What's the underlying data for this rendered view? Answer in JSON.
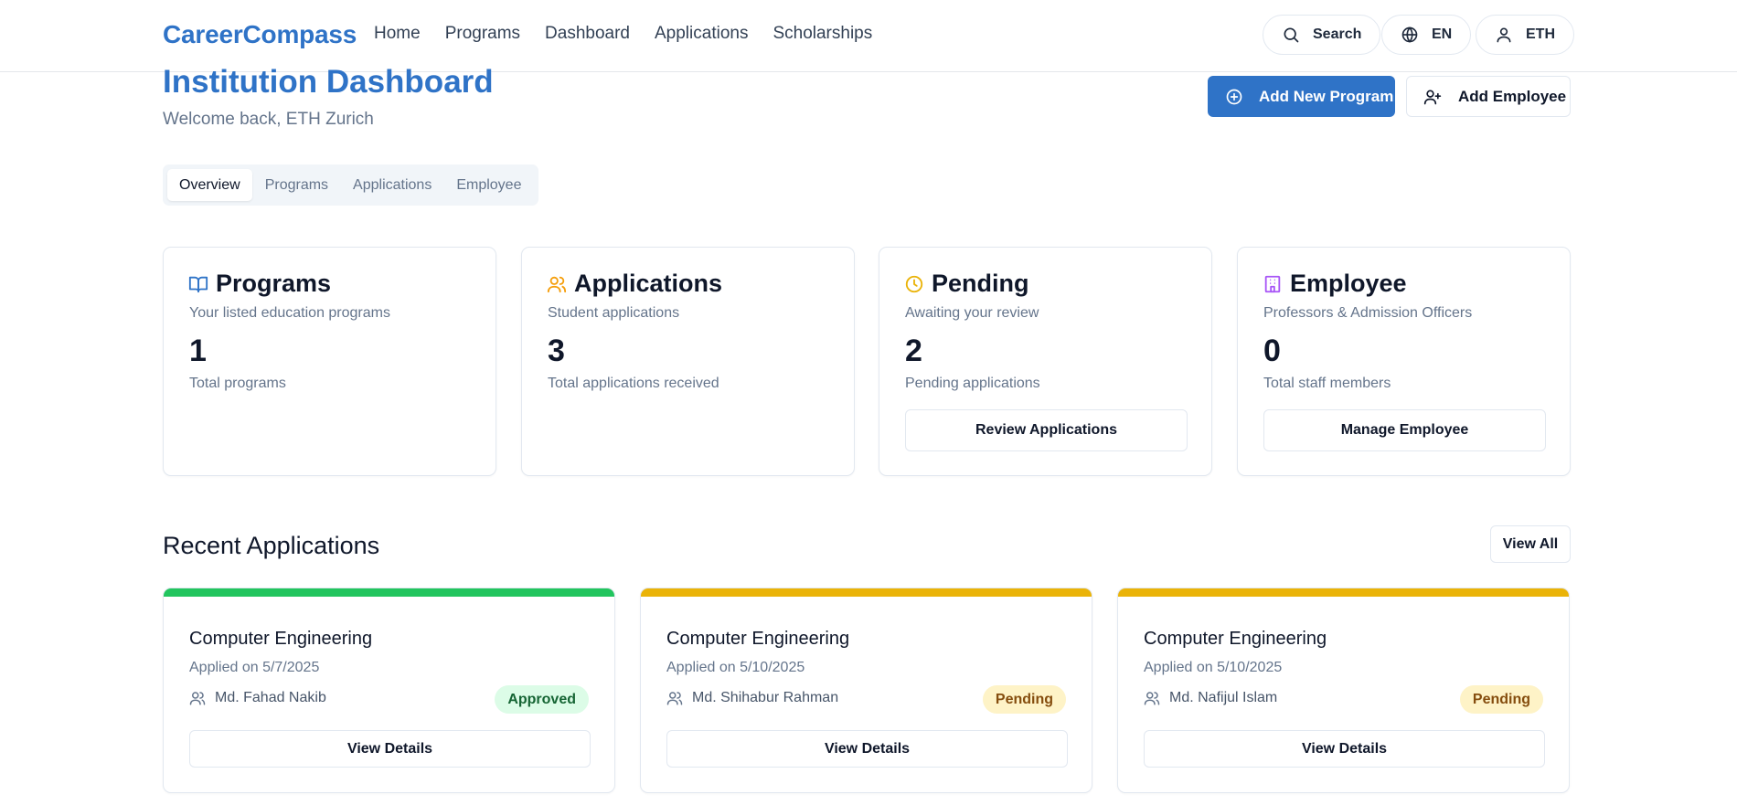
{
  "nav": {
    "brand": "CareerCompass",
    "links": [
      "Home",
      "Programs",
      "Dashboard",
      "Applications",
      "Scholarships"
    ],
    "search_label": "Search",
    "language_label": "EN",
    "user_label": "ETH"
  },
  "header": {
    "title": "Institution Dashboard",
    "welcome": "Welcome back, ETH Zurich",
    "add_program_label": "Add New Program",
    "add_employee_label": "Add Employee"
  },
  "tabs": [
    "Overview",
    "Programs",
    "Applications",
    "Employee"
  ],
  "stats": [
    {
      "icon": "book-open-icon",
      "title": "Programs",
      "subtitle": "Your listed education programs",
      "value": "1",
      "label": "Total programs",
      "color": "#2f73c7"
    },
    {
      "icon": "users-icon",
      "title": "Applications",
      "subtitle": "Student applications",
      "value": "3",
      "label": "Total applications received",
      "color": "#f59e0b"
    },
    {
      "icon": "clock-icon",
      "title": "Pending",
      "subtitle": "Awaiting your review",
      "value": "2",
      "label": "Pending applications",
      "button": "Review Applications",
      "color": "#eab308"
    },
    {
      "icon": "building-icon",
      "title": "Employee",
      "subtitle": "Professors & Admission Officers",
      "value": "0",
      "label": "Total staff members",
      "button": "Manage Employee",
      "color": "#a855f7"
    }
  ],
  "recent": {
    "title": "Recent Applications",
    "view_all": "View All",
    "items": [
      {
        "program": "Computer Engineering",
        "date": "Applied on 5/7/2025",
        "applicant": "Md. Fahad Nakib",
        "status": "Approved",
        "bar_color": "#22c55e",
        "action": "View Details"
      },
      {
        "program": "Computer Engineering",
        "date": "Applied on 5/10/2025",
        "applicant": "Md. Shihabur Rahman",
        "status": "Pending",
        "bar_color": "#eab308",
        "action": "View Details"
      },
      {
        "program": "Computer Engineering",
        "date": "Applied on 5/10/2025",
        "applicant": "Md. Nafijul Islam",
        "status": "Pending",
        "bar_color": "#eab308",
        "action": "View Details"
      }
    ]
  }
}
